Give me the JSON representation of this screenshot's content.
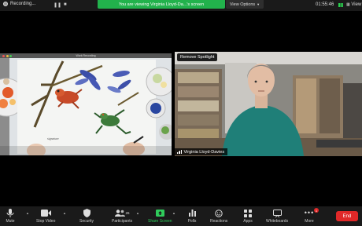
{
  "top_bar": {
    "recording_label": "Recording...",
    "viewing_banner": "You are viewing Virginia Lloyd-Da...'s screen",
    "view_options_label": "View Options",
    "clock": "01:55:46",
    "view_label": "View"
  },
  "shared_screen": {
    "window_title": "Work Recording"
  },
  "video": {
    "spotlight_button": "Remove Spotlight",
    "participant_name": "Virginia Lloyd-Davies"
  },
  "toolbar": {
    "mute": "Mute",
    "stop_video": "Stop Video",
    "security": "Security",
    "participants": "Participants",
    "participants_count": "26",
    "share_screen": "Share Screen",
    "polls": "Polls",
    "reactions": "Reactions",
    "apps": "Apps",
    "whiteboards": "Whiteboards",
    "more": "More",
    "more_badge": "1",
    "end": "End"
  },
  "colors": {
    "accent_green": "#2fcc5b",
    "end_red": "#e02828",
    "banner_green": "#22b24c"
  }
}
